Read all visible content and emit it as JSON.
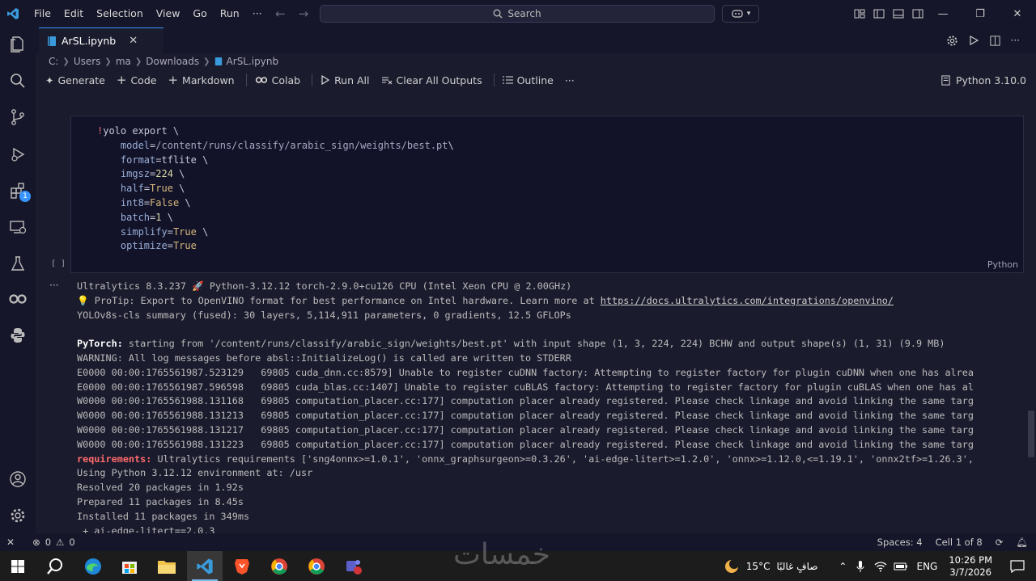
{
  "menu": [
    "File",
    "Edit",
    "Selection",
    "View",
    "Go",
    "Run",
    "···"
  ],
  "search": {
    "label": "Search"
  },
  "tab": {
    "label": "ArSL.ipynb"
  },
  "breadcrumb": [
    "C:",
    "Users",
    "ma",
    "Downloads",
    "ArSL.ipynb"
  ],
  "toolbar": {
    "generate": "Generate",
    "code": "Code",
    "markdown": "Markdown",
    "colab": "Colab",
    "run_all": "Run All",
    "clear_outputs": "Clear All Outputs",
    "outline": "Outline",
    "more": "···",
    "kernel": "Python 3.10.0"
  },
  "cell": {
    "exec_count": "[ ]",
    "language": "Python",
    "lines": [
      {
        "bang": "!",
        "cmd": "yolo export \\"
      },
      {
        "key": "model",
        "val": "/content/runs/classify/arabic_sign/weights/best.pt",
        "tail": "\\",
        "type": "str"
      },
      {
        "key": "format",
        "val": "tflite",
        "tail": " \\",
        "type": "cmd"
      },
      {
        "key": "imgsz",
        "val": "224",
        "tail": " \\",
        "type": "num"
      },
      {
        "key": "half",
        "val": "True",
        "tail": " \\",
        "type": "lit"
      },
      {
        "key": "int8",
        "val": "False",
        "tail": " \\",
        "type": "lit"
      },
      {
        "key": "batch",
        "val": "1",
        "tail": " \\",
        "type": "num"
      },
      {
        "key": "simplify",
        "val": "True",
        "tail": " \\",
        "type": "lit"
      },
      {
        "key": "optimize",
        "val": "True",
        "tail": "",
        "type": "lit"
      }
    ]
  },
  "output": {
    "more": "···",
    "lines": [
      "Ultralytics 8.3.237 🚀 Python-3.12.12 torch-2.9.0+cu126 CPU (Intel Xeon CPU @ 2.00GHz)",
      "💡 ProTip: Export to OpenVINO format for best performance on Intel hardware. Learn more at ",
      "YOLOv8s-cls summary (fused): 30 layers, 5,114,911 parameters, 0 gradients, 12.5 GFLOPs",
      "",
      " starting from '/content/runs/classify/arabic_sign/weights/best.pt' with input shape (1, 3, 224, 224) BCHW and output shape(s) (1, 31) (9.9 MB)",
      "WARNING: All log messages before absl::InitializeLog() is called are written to STDERR",
      "E0000 00:00:1765561987.523129   69805 cuda_dnn.cc:8579] Unable to register cuDNN factory: Attempting to register factory for plugin cuDNN when one has alrea",
      "E0000 00:00:1765561987.596598   69805 cuda_blas.cc:1407] Unable to register cuBLAS factory: Attempting to register factory for plugin cuBLAS when one has al",
      "W0000 00:00:1765561988.131168   69805 computation_placer.cc:177] computation placer already registered. Please check linkage and avoid linking the same targ",
      "W0000 00:00:1765561988.131213   69805 computation_placer.cc:177] computation placer already registered. Please check linkage and avoid linking the same targ",
      "W0000 00:00:1765561988.131217   69805 computation_placer.cc:177] computation placer already registered. Please check linkage and avoid linking the same targ",
      "W0000 00:00:1765561988.131223   69805 computation_placer.cc:177] computation placer already registered. Please check linkage and avoid linking the same targ",
      " Ultralytics requirements ['sng4onnx>=1.0.1', 'onnx_graphsurgeon>=0.3.26', 'ai-edge-litert>=1.2.0', 'onnx>=1.12.0,<=1.19.1', 'onnx2tf>=1.26.3',",
      "Using Python 3.12.12 environment at: /usr",
      "Resolved 20 packages in 1.92s",
      "Prepared 11 packages in 8.45s",
      "Installed 11 packages in 349ms",
      " + ai-edge-litert==2.0.3"
    ],
    "link": "https://docs.ultralytics.com/integrations/openvino/",
    "pytorch_label": "PyTorch:",
    "requirements_label": "requirements:"
  },
  "status": {
    "errors": "0",
    "warnings": "0",
    "spaces": "Spaces: 4",
    "cell": "Cell 1 of 8"
  },
  "taskbar": {
    "weather_temp": "15°C",
    "weather_desc": "صافٍ غالبًا",
    "lang": "ENG",
    "time": "10:26 PM",
    "date": "3/7/2026",
    "watermark": "خمسات"
  }
}
